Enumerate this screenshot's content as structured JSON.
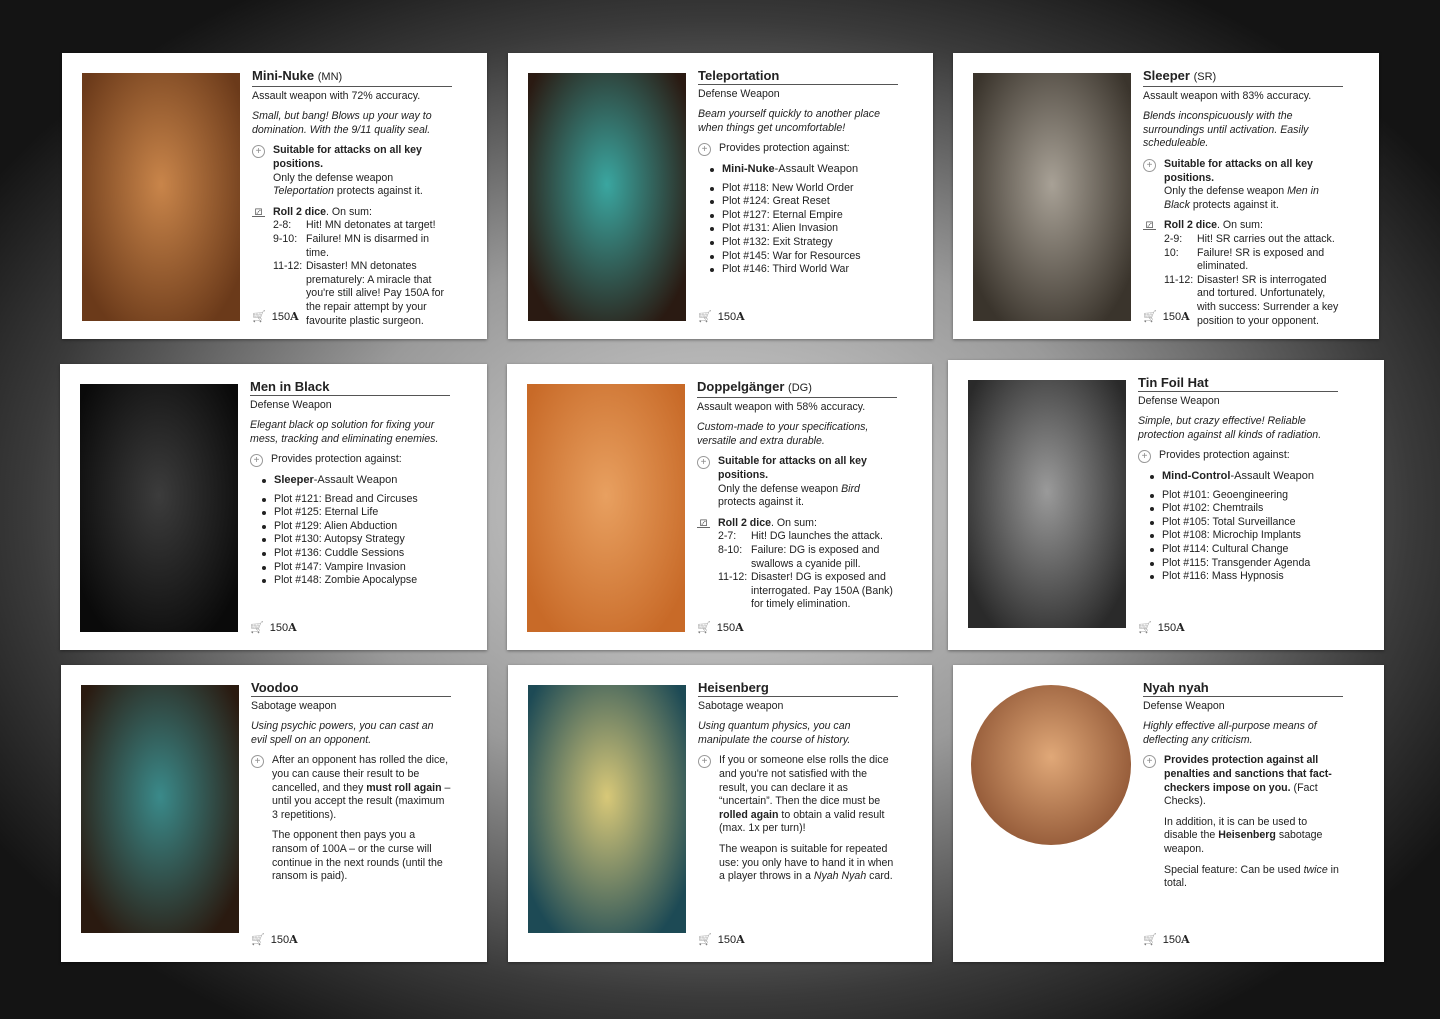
{
  "currency_symbol": "A",
  "cards": [
    {
      "title": "Mini-Nuke",
      "abbr": "(MN)",
      "type": "Assault weapon with 72% accuracy.",
      "tagline": "Small, but bang! Blows up your way to domination. With the 9/11 quality seal.",
      "icon_colors": [
        "#6b3a1a",
        "#c9854a"
      ],
      "attack": [
        [
          {
            "t": "Suitable for attacks on all key positions.",
            "b": 1
          }
        ],
        [
          {
            "t": "Only the defense weapon "
          },
          {
            "t": "Teleportation",
            "i": 1
          },
          {
            "t": " protects against it."
          }
        ]
      ],
      "roll": {
        "lead": [
          {
            "t": "Roll 2 dice",
            "b": 1
          },
          {
            "t": ". On sum:"
          }
        ],
        "rows": [
          {
            "r": "2-8:",
            "t": "Hit! MN detonates at target!"
          },
          {
            "r": "9-10:",
            "t": "Failure! MN is disarmed in time."
          },
          {
            "r": "11-12:",
            "t": "Disaster! MN detonates prematurely: A miracle that you're still alive! Pay 150A for the repair attempt by your favourite plastic surgeon."
          }
        ]
      },
      "price": "150"
    },
    {
      "title": "Teleportation",
      "type": "Defense Weapon",
      "tagline": "Beam yourself quickly to another place when things get uncomfortable!",
      "icon_colors": [
        "#2a1a12",
        "#3aa6a0"
      ],
      "protect_label": "Provides protection against:",
      "list_first": [
        {
          "t": "Mini-Nuke",
          "b": 1
        },
        {
          "t": "-Assault Weapon"
        }
      ],
      "list": [
        "Plot #118: New World Order",
        "Plot #124: Great Reset",
        "Plot #127: Eternal Empire",
        "Plot #131: Alien Invasion",
        "Plot #132: Exit Strategy",
        "Plot #145: War for Resources",
        "Plot #146: Third World War"
      ],
      "price": "150"
    },
    {
      "title": "Sleeper",
      "abbr": "(SR)",
      "type": "Assault weapon with 83% accuracy.",
      "tagline": "Blends inconspicuously with the surroundings until activation. Easily scheduleable.",
      "icon_colors": [
        "#3a342c",
        "#a8a196"
      ],
      "attack": [
        [
          {
            "t": "Suitable for attacks on all key positions.",
            "b": 1
          }
        ],
        [
          {
            "t": "Only the defense weapon "
          },
          {
            "t": "Men in Black",
            "i": 1
          },
          {
            "t": " protects against it."
          }
        ]
      ],
      "roll": {
        "lead": [
          {
            "t": "Roll 2 dice",
            "b": 1
          },
          {
            "t": ". On sum:"
          }
        ],
        "rows": [
          {
            "r": "2-9:",
            "t": "Hit! SR carries out the attack."
          },
          {
            "r": "10:",
            "t": "Failure! SR is exposed and eliminated."
          },
          {
            "r": "11-12:",
            "t": "Disaster! SR is interrogated and tortured. Unfortunately, with success: Surrender a key position to your opponent."
          }
        ]
      },
      "price": "150"
    },
    {
      "title": "Men in Black",
      "type": "Defense Weapon",
      "tagline": "Elegant black op solution for fixing your mess, tracking and eliminating enemies.",
      "icon_colors": [
        "#0a0a0a",
        "#3c3c3c"
      ],
      "protect_label": "Provides protection against:",
      "list_first": [
        {
          "t": "Sleeper",
          "b": 1
        },
        {
          "t": "-Assault Weapon"
        }
      ],
      "list": [
        "Plot #121: Bread and Circuses",
        "Plot #125: Eternal Life",
        "Plot #129: Alien Abduction",
        "Plot #130: Autopsy Strategy",
        "Plot #136: Cuddle Sessions",
        "Plot #147: Vampire Invasion",
        "Plot #148: Zombie Apocalypse"
      ],
      "price": "150"
    },
    {
      "title": "Doppelgänger",
      "abbr": "(DG)",
      "type": "Assault weapon with 58% accuracy.",
      "tagline": "Custom-made to your specifications, versatile and extra durable.",
      "icon_colors": [
        "#c86a28",
        "#e8a060"
      ],
      "attack": [
        [
          {
            "t": "Suitable for attacks on all key positions.",
            "b": 1
          }
        ],
        [
          {
            "t": "Only the defense weapon "
          },
          {
            "t": "Bird",
            "i": 1
          },
          {
            "t": " protects against it."
          }
        ]
      ],
      "roll": {
        "lead": [
          {
            "t": "Roll 2 dice",
            "b": 1
          },
          {
            "t": ". On sum:"
          }
        ],
        "rows": [
          {
            "r": "2-7:",
            "t": "Hit! DG launches the attack."
          },
          {
            "r": "8-10:",
            "t": "Failure: DG is exposed and swallows a cyanide pill."
          },
          {
            "r": "11-12:",
            "t": "Disaster! DG is exposed and interrogated. Pay 150A (Bank) for timely elimination."
          }
        ]
      },
      "price": "150"
    },
    {
      "title": "Tin Foil Hat",
      "type": "Defense Weapon",
      "tagline": "Simple, but crazy effective! Reliable protection against all kinds of radiation.",
      "icon_colors": [
        "#2a2a2a",
        "#9a9a9a"
      ],
      "protect_label": "Provides protection against:",
      "list_first": [
        {
          "t": "Mind-Control",
          "b": 1
        },
        {
          "t": "-Assault Weapon"
        }
      ],
      "list": [
        "Plot #101: Geoengineering",
        "Plot #102: Chemtrails",
        "Plot #105: Total Surveillance",
        "Plot #108: Microchip Implants",
        "Plot #114: Cultural Change",
        "Plot #115: Transgender Agenda",
        "Plot #116: Mass Hypnosis"
      ],
      "price": "150"
    },
    {
      "title": "Voodoo",
      "type": "Sabotage weapon",
      "tagline": "Using psychic powers, you can cast an evil spell on an opponent.",
      "icon_colors": [
        "#2a1a10",
        "#3a8a8a"
      ],
      "effect": [
        [
          {
            "t": "After an opponent has rolled the dice, you can cause their result to be cancelled, and they "
          },
          {
            "t": "must roll again",
            "b": 1
          },
          {
            "t": " – until you accept the result (maximum 3 repetitions)."
          }
        ],
        [
          {
            "t": "The opponent then pays you a ransom of 100A – or the curse will continue in the next rounds (until the ransom is paid)."
          }
        ]
      ],
      "price": "150"
    },
    {
      "title": "Heisenberg",
      "type": "Sabotage weapon",
      "tagline": "Using quantum physics, you can manipulate the course of history.",
      "icon_colors": [
        "#1d4a55",
        "#d8c878"
      ],
      "effect": [
        [
          {
            "t": "If you or someone else rolls the dice and you're not satisfied with the result, you can declare it as “uncertain”. Then the dice must be "
          },
          {
            "t": "rolled again",
            "b": 1
          },
          {
            "t": " to obtain a valid result (max. 1x per turn)!"
          }
        ],
        [
          {
            "t": "The weapon is suitable for repeated use: you only have to hand it in when a player throws in a "
          },
          {
            "t": "Nyah Nyah",
            "i": 1
          },
          {
            "t": " card."
          }
        ]
      ],
      "price": "150"
    },
    {
      "title": "Nyah nyah",
      "type": "Defense Weapon",
      "tagline": "Highly effective all-purpose means of deflecting any criticism.",
      "icon_colors": [
        "#8a5030",
        "#e0a878"
      ],
      "effect": [
        [
          {
            "t": "Provides protection against all penalties and sanctions that fact-checkers impose on you.",
            "b": 1
          },
          {
            "t": " (Fact Checks)."
          }
        ],
        [
          {
            "t": "In addition, it is can be used to disable the "
          },
          {
            "t": "Heisenberg",
            "b": 1
          },
          {
            "t": " sabotage weapon."
          }
        ],
        [
          {
            "t": "Special feature: Can be used "
          },
          {
            "t": "twice",
            "i": 1
          },
          {
            "t": " in total."
          }
        ]
      ],
      "price": "150"
    }
  ]
}
